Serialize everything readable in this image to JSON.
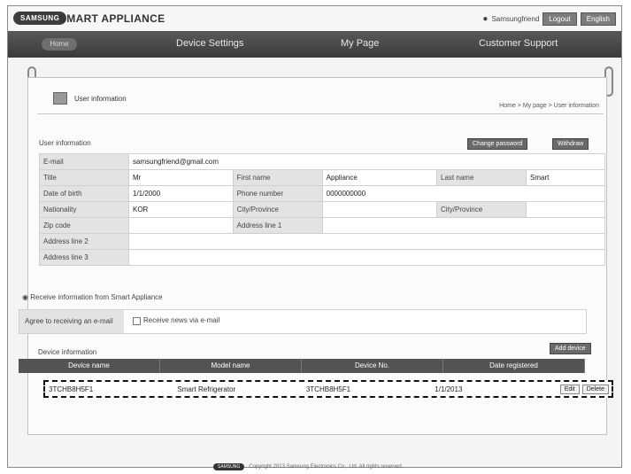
{
  "header": {
    "logo": "SAMSUNG",
    "brand": "SMART APPLIANCE",
    "user_text": "Samsungfriend",
    "logout_label": "Logout",
    "english_label": "English"
  },
  "nav": {
    "home": "Home",
    "items": [
      "Device Settings",
      "My Page",
      "Customer Support"
    ]
  },
  "page": {
    "title": "User information",
    "links": "Home > My page > User information"
  },
  "user_section": {
    "title": "User information",
    "btn_change_password": "Change password",
    "btn_withdraw": "Withdraw",
    "email_label": "E-mail",
    "email_value": "samsungfriend@gmail.com",
    "title_label": "Title",
    "title_value": "Mr",
    "first_name_label": "First name",
    "first_name_value": "Appliance",
    "last_name_label": "Last name",
    "last_name_value": "Smart",
    "dob_label": "Date of birth",
    "dob_value": "1/1/2000",
    "phone_label": "Phone number",
    "phone_value": "0000000000",
    "nationality_label": "Nationality",
    "nationality_value": "KOR",
    "city_label": "City/Province",
    "city_value": "",
    "city_label2": "City/Province",
    "city_value2": "",
    "zip_label": "Zip code",
    "address1_label": "Address line 1",
    "address2_label": "Address line 2",
    "address3_label": "Address line 3"
  },
  "option_text": "Receive information from Smart Appliance",
  "promo": {
    "label": "Agree to receiving an e-mail",
    "text": "Receive news via e-mail"
  },
  "device_section": {
    "title": "Device information",
    "btn_add": "Add device",
    "headers": [
      "Device name",
      "Model name",
      "Device No.",
      "Date registered"
    ],
    "row": {
      "name": "3TCHB8H5F1",
      "model": "Smart Refrigerator",
      "number": "3TCHB8H5F1",
      "date": "1/1/2013",
      "edit": "Edit",
      "delete": "Delete"
    }
  },
  "footer": {
    "logo": "SAMSUNG",
    "copyright": "Copyright 2013 Samsung Electronics Co., Ltd. All rights reserved."
  }
}
